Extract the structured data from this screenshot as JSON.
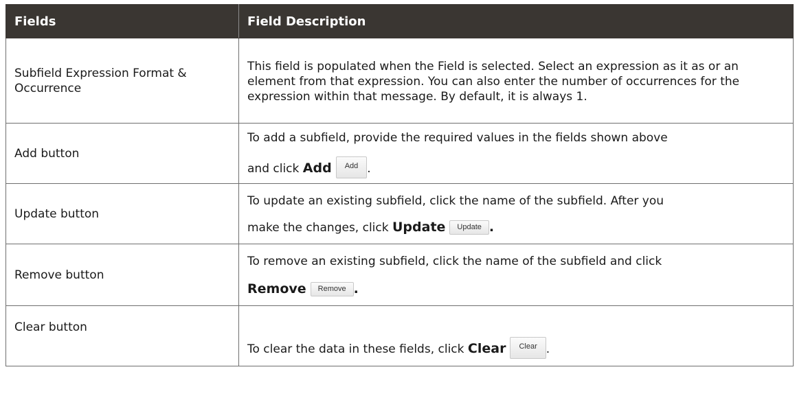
{
  "table": {
    "headers": {
      "col1": "Fields",
      "col2": "Field Description"
    },
    "rows": [
      {
        "field": "Subfield Expression Format & Occurrence",
        "description": "This field is populated when the Field is selected. Select an expression as it as or an element from that expression. You can also enter the number of occurrences for the expression within that message. By default, it is always 1."
      },
      {
        "field": "Add button",
        "text_line1": "To add a subfield, provide the required values in the fields shown above",
        "text_prefix": "and click ",
        "bold_label": "Add",
        "button_label": "Add",
        "suffix": "."
      },
      {
        "field": "Update button",
        "text_line1": "To update an existing subfield, click the name of the subfield. After you",
        "text_prefix": "make the changes, click ",
        "bold_label": "Update",
        "button_label": "Update",
        "suffix": "."
      },
      {
        "field": "Remove button",
        "text_line1": "To remove an existing subfield, click the name of the subfield and click",
        "bold_label": "Remove",
        "button_label": "Remove",
        "suffix": "."
      },
      {
        "field": "Clear button",
        "text_prefix": "To clear the data in these fields, click ",
        "bold_label": "Clear",
        "button_label": "Clear",
        "suffix": "."
      }
    ]
  }
}
